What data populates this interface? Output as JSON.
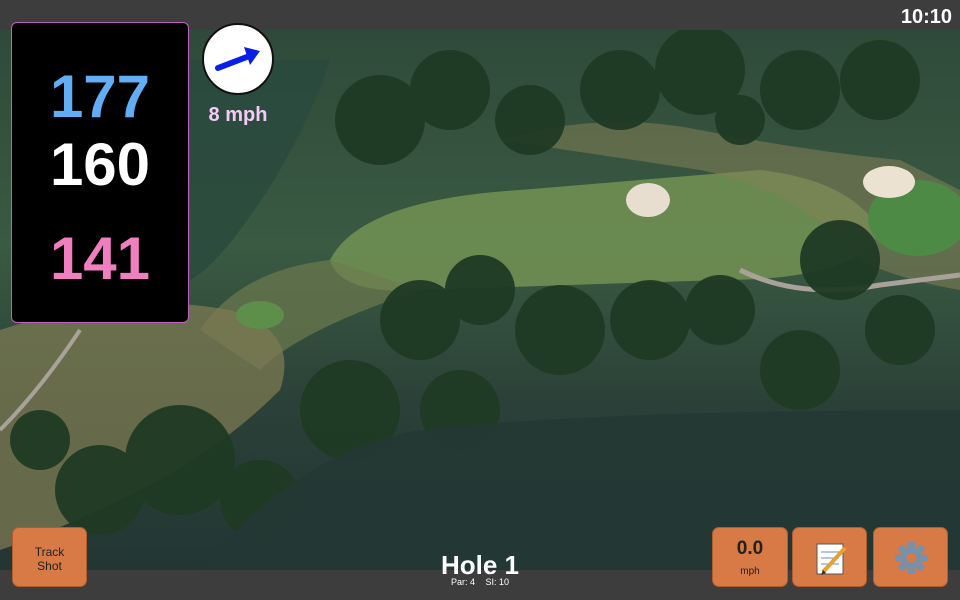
{
  "clock": "10:10",
  "distances": {
    "back": "177",
    "middle": "160",
    "front": "141"
  },
  "wind": {
    "speed_label": "8 mph",
    "icon": "wind-direction-arrow-icon"
  },
  "buttons": {
    "track_shot_line1": "Track",
    "track_shot_line2": "Shot",
    "speed_value": "0.0",
    "speed_unit": "mph",
    "notes_icon": "notepad-icon",
    "settings_icon": "gear-icon"
  },
  "hole": {
    "title": "Hole 1",
    "par": "Par: 4",
    "si": "SI: 10"
  },
  "colors": {
    "back": "#62aef5",
    "middle": "#ffffff",
    "front": "#f07fc0",
    "button": "#d77a45",
    "wind_label": "#f6c9f6"
  }
}
